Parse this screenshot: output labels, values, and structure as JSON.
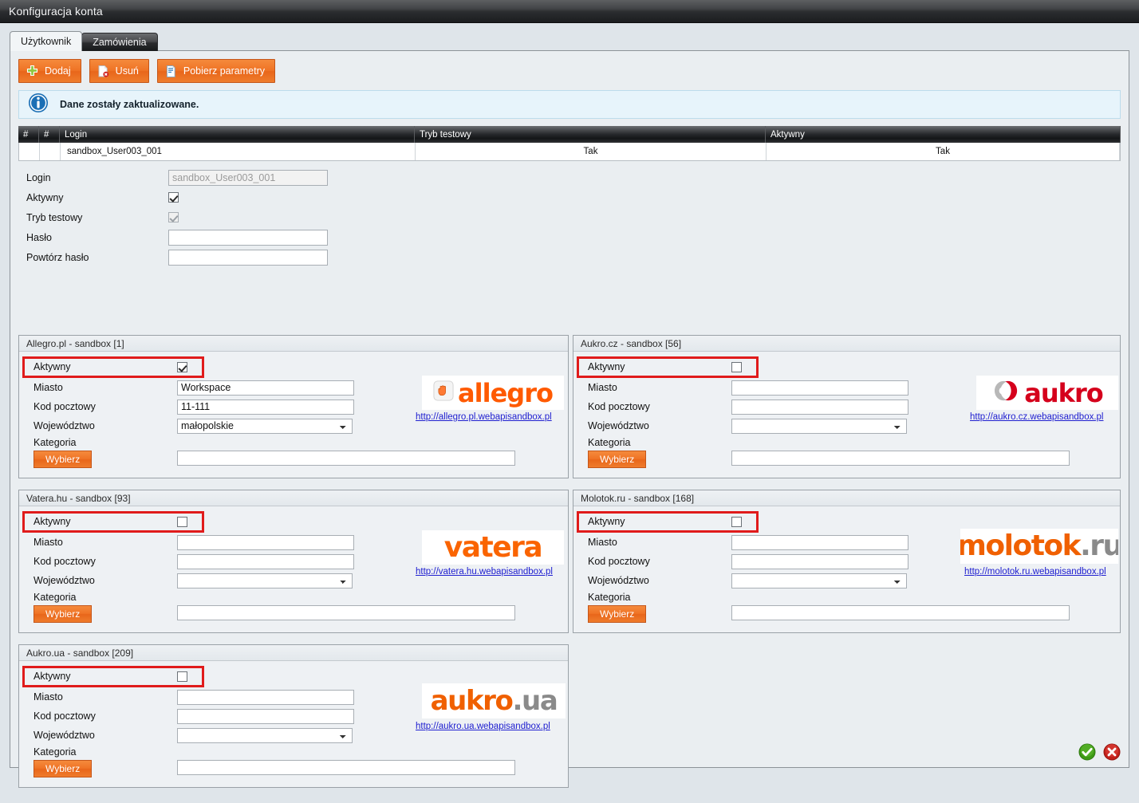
{
  "window": {
    "title": "Konfiguracja konta"
  },
  "tabs": [
    {
      "label": "Użytkownik",
      "active": true
    },
    {
      "label": "Zamówienia",
      "active": false
    }
  ],
  "toolbar": {
    "add_label": "Dodaj",
    "delete_label": "Usuń",
    "fetch_label": "Pobierz parametry",
    "add_icon": "plus-icon",
    "delete_icon": "document-delete-icon",
    "fetch_icon": "document-download-icon",
    "accent_color": "#ef7325"
  },
  "infobar": {
    "icon": "info-icon",
    "message": "Dane zostały zaktualizowane.",
    "background": "#e7f4fb"
  },
  "grid": {
    "headers": [
      "#",
      "#",
      "Login",
      "Tryb testowy",
      "Aktywny"
    ],
    "rows": [
      {
        "num1": "",
        "num2": "",
        "login": "sandbox_User003_001",
        "test_mode": "Tak",
        "active": "Tak"
      }
    ]
  },
  "user_form": {
    "login": {
      "label": "Login",
      "value": "sandbox_User003_001",
      "readonly": true
    },
    "active": {
      "label": "Aktywny",
      "checked": true,
      "disabled": false
    },
    "test_mode": {
      "label": "Tryb testowy",
      "checked": true,
      "disabled": true
    },
    "password": {
      "label": "Hasło",
      "value": ""
    },
    "password_repeat": {
      "label": "Powtórz hasło",
      "value": ""
    }
  },
  "field_labels": {
    "active": "Aktywny",
    "city": "Miasto",
    "postcode": "Kod pocztowy",
    "province": "Województwo",
    "category": "Kategoria",
    "choose": "Wybierz"
  },
  "marketplaces": [
    {
      "title": "Allegro.pl - sandbox [1]",
      "active": true,
      "city": "Workspace",
      "postcode": "11-111",
      "province": "małopolskie",
      "category": "",
      "link": "http://allegro.pl.webapisandbox.pl",
      "logo": {
        "name": "allegro-logo",
        "text": "allegro",
        "color": "#ff5a00",
        "suffix": "",
        "suffix_color": ""
      }
    },
    {
      "title": "Aukro.cz - sandbox [56]",
      "active": false,
      "city": "",
      "postcode": "",
      "province": "",
      "category": "",
      "link": "http://aukro.cz.webapisandbox.pl",
      "logo": {
        "name": "aukro-cz-logo",
        "text": "aukro",
        "color": "#d5001c",
        "suffix": "",
        "suffix_color": ""
      }
    },
    {
      "title": "Vatera.hu - sandbox [93]",
      "active": false,
      "city": "",
      "postcode": "",
      "province": "",
      "category": "",
      "link": "http://vatera.hu.webapisandbox.pl",
      "logo": {
        "name": "vatera-logo",
        "text": "vatera",
        "color": "#fa6400",
        "suffix": "",
        "suffix_color": ""
      }
    },
    {
      "title": "Molotok.ru - sandbox [168]",
      "active": false,
      "city": "",
      "postcode": "",
      "province": "",
      "category": "",
      "link": "http://molotok.ru.webapisandbox.pl",
      "logo": {
        "name": "molotok-logo",
        "text": "molotok",
        "color": "#f06000",
        "suffix": ".ru",
        "suffix_color": "#8a8a8a"
      }
    },
    {
      "title": "Aukro.ua - sandbox [209]",
      "active": false,
      "city": "",
      "postcode": "",
      "province": "",
      "category": "",
      "link": "http://aukro.ua.webapisandbox.pl",
      "logo": {
        "name": "aukro-ua-logo",
        "text": "aukro",
        "color": "#f06000",
        "suffix": ".ua",
        "suffix_color": "#8a8a8a"
      }
    }
  ],
  "footer": {
    "confirm_icon": "check-circle-icon",
    "cancel_icon": "close-circle-icon",
    "confirm_color": "#3d9a15",
    "cancel_color": "#c1201a"
  }
}
